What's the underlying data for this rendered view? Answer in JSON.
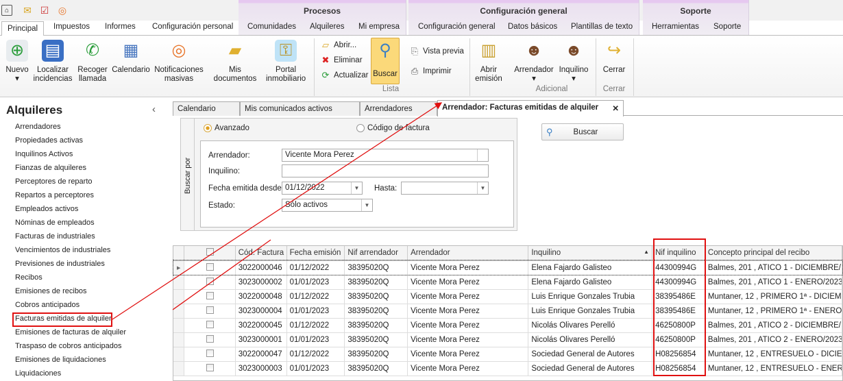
{
  "quick_access": [
    "app-icon",
    "mail-icon",
    "clipboard-icon",
    "broadcast-icon"
  ],
  "context_groups": [
    "Procesos",
    "Configuración general",
    "Soporte"
  ],
  "ribbon_tabs": [
    "Principal",
    "Impuestos",
    "Informes",
    "Configuración personal",
    "Comunidades",
    "Alquileres",
    "Mi empresa",
    "Configuración general",
    "Datos básicos",
    "Plantillas de texto",
    "Herramientas",
    "Soporte"
  ],
  "ribbon": {
    "big": [
      "Nuevo",
      "Localizar incidencias",
      "Recoger llamada",
      "Calendario",
      "Notificaciones masivas",
      "Mis documentos",
      "Portal inmobiliario"
    ],
    "lista": {
      "abrir": "Abrir...",
      "eliminar": "Eliminar",
      "actualizar": "Actualizar",
      "buscar": "Buscar",
      "vista_previa": "Vista previa",
      "imprimir": "Imprimir",
      "group": "Lista"
    },
    "adicional": {
      "abrir_emision": "Abrir emisión",
      "arrendador": "Arrendador",
      "inquilino": "Inquilino",
      "group": "Adicional"
    },
    "cerrar": {
      "label": "Cerrar",
      "group": "Cerrar"
    }
  },
  "sidebar": {
    "title": "Alquileres",
    "collapse": "‹",
    "items": [
      "Arrendadores",
      "Propiedades activas",
      "Inquilinos Activos",
      "Fianzas de alquileres",
      "Perceptores de reparto",
      "Repartos a perceptores",
      "Empleados activos",
      "Nóminas de empleados",
      "Facturas de industriales",
      "Vencimientos de industriales",
      "Previsiones de industriales",
      "Recibos",
      "Emisiones de recibos",
      "Cobros anticipados",
      "Facturas emitidas de alquiler",
      "Emisiones de facturas de alquiler",
      "Traspaso de cobros anticipados",
      "Emisiones de liquidaciones",
      "Liquidaciones"
    ]
  },
  "doc_tabs": [
    "Calendario",
    "Mis comunicados activos",
    "Arrendadores",
    "Arrendador: Facturas emitidas de alquiler"
  ],
  "search": {
    "side_label": "Buscar por",
    "radio_avanzado": "Avanzado",
    "radio_codigo": "Código de factura",
    "buscar": "Buscar",
    "arrendador_label": "Arrendador:",
    "arrendador_value": "Vicente Mora Perez",
    "inquilino_label": "Inquilino:",
    "inquilino_value": "",
    "fecha_label": "Fecha emitida desde:",
    "fecha_value": "01/12/2022",
    "hasta_label": "Hasta:",
    "hasta_value": "",
    "estado_label": "Estado:",
    "estado_value": "Sólo activos"
  },
  "grid": {
    "columns": [
      "Cód. Factura",
      "Fecha emisión",
      "Nif arrendador",
      "Arrendador",
      "Inquilino",
      "Nif inquilino",
      "Concepto principal del recibo"
    ],
    "rows": [
      [
        "3022000046",
        "01/12/2022",
        "38395020Q",
        "Vicente Mora Perez",
        "Elena Fajardo Galisteo",
        "44300994G",
        "Balmes, 201 , ATICO 1 - DICIEMBRE/..."
      ],
      [
        "3023000002",
        "01/01/2023",
        "38395020Q",
        "Vicente Mora Perez",
        "Elena Fajardo Galisteo",
        "44300994G",
        "Balmes, 201 , ATICO 1 - ENERO/2023"
      ],
      [
        "3022000048",
        "01/12/2022",
        "38395020Q",
        "Vicente Mora Perez",
        "Luis Enrique Gonzales Trubia",
        "38395486E",
        "Muntaner, 12 , PRIMERO 1ª - DICIEM..."
      ],
      [
        "3023000004",
        "01/01/2023",
        "38395020Q",
        "Vicente Mora Perez",
        "Luis Enrique Gonzales Trubia",
        "38395486E",
        "Muntaner, 12 , PRIMERO 1ª - ENERO..."
      ],
      [
        "3022000045",
        "01/12/2022",
        "38395020Q",
        "Vicente Mora Perez",
        "Nicolás Olivares Perelló",
        "46250800P",
        "Balmes, 201 , ATICO 2 - DICIEMBRE/..."
      ],
      [
        "3023000001",
        "01/01/2023",
        "38395020Q",
        "Vicente Mora Perez",
        "Nicolás Olivares Perelló",
        "46250800P",
        "Balmes, 201 , ATICO 2 - ENERO/2023"
      ],
      [
        "3022000047",
        "01/12/2022",
        "38395020Q",
        "Vicente Mora Perez",
        "Sociedad General de Autores",
        "H08256854",
        "Muntaner, 12 , ENTRESUELO - DICIE..."
      ],
      [
        "3023000003",
        "01/01/2023",
        "38395020Q",
        "Vicente Mora Perez",
        "Sociedad General de Autores",
        "H08256854",
        "Muntaner, 12 , ENTRESUELO - ENER..."
      ]
    ]
  },
  "colors": {
    "annotation": "#e01010",
    "context": "#e6c8f0",
    "buscar_active": "#fbd97a"
  }
}
